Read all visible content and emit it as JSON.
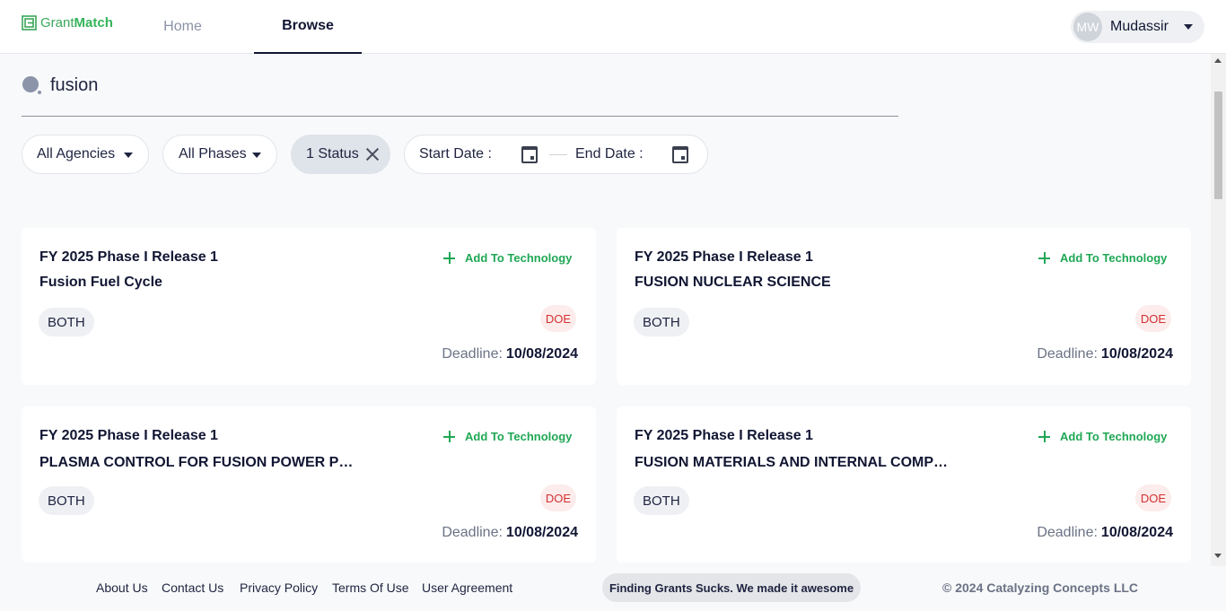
{
  "header": {
    "logo": {
      "grant": "Grant",
      "match": "Match"
    },
    "nav": [
      {
        "label": "Home"
      },
      {
        "label": "Browse"
      }
    ],
    "user": {
      "initials": "MW",
      "name": "Mudassir"
    }
  },
  "search": {
    "value": "fusion"
  },
  "filters": {
    "agencies": "All Agencies",
    "phases": "All Phases",
    "status": "1 Status",
    "start_date": "Start Date :",
    "end_date": "End Date :"
  },
  "cards": [
    {
      "phase": "FY 2025 Phase I Release 1",
      "title": "Fusion Fuel Cycle",
      "action": "Add To Technology",
      "type": "BOTH",
      "agency": "DOE",
      "deadline_label": "Deadline:",
      "deadline": "10/08/2024"
    },
    {
      "phase": "FY 2025 Phase I Release 1",
      "title": "FUSION NUCLEAR SCIENCE",
      "action": "Add To Technology",
      "type": "BOTH",
      "agency": "DOE",
      "deadline_label": "Deadline:",
      "deadline": "10/08/2024"
    },
    {
      "phase": "FY 2025 Phase I Release 1",
      "title": "PLASMA CONTROL FOR FUSION POWER PL...",
      "action": "Add To Technology",
      "type": "BOTH",
      "agency": "DOE",
      "deadline_label": "Deadline:",
      "deadline": "10/08/2024"
    },
    {
      "phase": "FY 2025 Phase I Release 1",
      "title": "FUSION MATERIALS AND INTERNAL COMPO...",
      "action": "Add To Technology",
      "type": "BOTH",
      "agency": "DOE",
      "deadline_label": "Deadline:",
      "deadline": "10/08/2024"
    }
  ],
  "footer": {
    "links": [
      "About Us",
      "Contact Us",
      "Privacy Policy",
      "Terms Of Use",
      "User Agreement"
    ],
    "tagline": "Finding Grants Sucks. We made it awesome",
    "copyright": "© 2024 Catalyzing Concepts LLC"
  },
  "colors": {
    "accent": "#1fa755",
    "agency": "#d32f2f",
    "text": "#111633"
  }
}
